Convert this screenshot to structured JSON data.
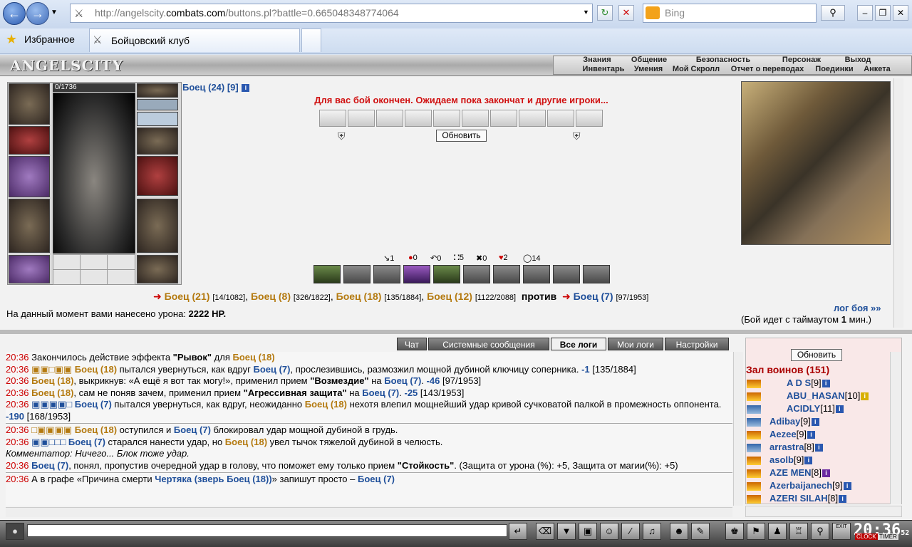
{
  "browser": {
    "url_prefix": "http://angelscity.",
    "url_domain": "combats.com",
    "url_rest": "/buttons.pl?battle=0.665048348774064",
    "search_placeholder": "Bing",
    "favorites_label": "Избранное",
    "tab_title": "Бойцовский клуб"
  },
  "game": {
    "logo": "ANGELSCITY",
    "menu_top": [
      "Знания",
      "Общение",
      "Безопасность",
      "Персонаж",
      "Выход"
    ],
    "menu_bottom": [
      "Инвентарь",
      "Умения",
      "Мой Скролл",
      "Отчет о переводах",
      "Поединки",
      "Анкета"
    ],
    "hp_label": "0/1736",
    "player_name": "Боец (24) [9]",
    "fight_message": "Для вас бой окончен. Ожидаем пока закончат и другие игроки...",
    "refresh_label": "Обновить",
    "stats": [
      "1",
      "0",
      "0",
      "5",
      "0",
      "2",
      "14"
    ],
    "team_a": [
      {
        "name": "Боец (21)",
        "hp": "[14/1082]"
      },
      {
        "name": "Боец (8)",
        "hp": "[326/1822]"
      },
      {
        "name": "Боец (18)",
        "hp": "[135/1884]"
      },
      {
        "name": "Боец (12)",
        "hp": "[1122/2088]"
      }
    ],
    "versus_label": "против",
    "team_b": [
      {
        "name": "Боец (7)",
        "hp": "[97/1953]"
      }
    ],
    "damage_prefix": "На данный момент вами нанесено урона:",
    "damage_value": "2222 HP.",
    "log_link": "лог боя »»",
    "timeout_prefix": "(Бой идет с таймаутом",
    "timeout_value": "1",
    "timeout_suffix": "мин.)"
  },
  "chat": {
    "tabs": [
      "Чат",
      "Системные сообщения",
      "Все логи",
      "Мои логи",
      "Настройки"
    ],
    "active_tab": "Все логи"
  },
  "log": [
    {
      "time": "20:36",
      "t1": "Закончилось действие эффекта ",
      "q1": "\"Рывок\"",
      "t2": " для ",
      "f1": "Боец (18)"
    },
    {
      "time": "20:36",
      "f1": "Боец (18)",
      "t1": " пытался увернуться, как вдруг ",
      "f2": "Боец (7)",
      "t2": ", прослезившись, размозжил мощной дубиной ключицу соперника. ",
      "d": "-1",
      "t3": "[135/1884]"
    },
    {
      "time": "20:36",
      "f1": "Боец (18)",
      "t1": ", выкрикнув: «А ещё я вот так могу!», применил прием ",
      "q1": "\"Возмездие\"",
      "t2": " на ",
      "f2": "Боец (7)",
      "d": "-46",
      "t3": "[97/1953]"
    },
    {
      "time": "20:36",
      "f1": "Боец (18)",
      "t1": ", сам не поняв зачем, применил прием ",
      "q1": "\"Агрессивная защита\"",
      "t2": " на ",
      "f2": "Боец (7)",
      "d": "-25",
      "t3": "[143/1953]"
    },
    {
      "time": "20:36",
      "f1": "Боец (7)",
      "t1": " пытался увернуться, как вдруг, неожиданно ",
      "f2": "Боец (18)",
      "t2": " нехотя влепил мощнейший удар кривой сучковатой палкой в промежность оппонента. ",
      "d": "-190",
      "t3": "[168/1953]"
    },
    {
      "time": "20:36",
      "f1": "Боец (18)",
      "t1": " оступился и ",
      "f2": "Боец (7)",
      "t2": " блокировал удар мощной дубиной в грудь."
    },
    {
      "time": "20:36",
      "f1": "Боец (7)",
      "t1": " старался нанести удар, но ",
      "f2": "Боец (18)",
      "t2": " увел тычок тяжелой дубиной в челюсть."
    },
    {
      "comment": "Комментатор: Ничего... Блок тоже удар."
    },
    {
      "time": "20:36",
      "f1": "Боец (7)",
      "t1": ", понял, пропустив очередной удар в голову, что поможет ему только прием ",
      "q1": "\"Стойкость\"",
      "t2": ". (Защита от урона (%): +5, Защита от магии(%): +5)"
    },
    {
      "time": "20:36",
      "t1": "А в графе «Причина смерти ",
      "q1": "Чертяка (зверь Боец (18))",
      "t2": "» запишут просто – ",
      "f2": "Боец (7)"
    }
  ],
  "room": {
    "refresh_label": "Обновить",
    "title": "Зал воинов (151)",
    "players": [
      {
        "name": "A D S",
        "level": "[9]"
      },
      {
        "name": "ABU_HASAN",
        "level": "[10]"
      },
      {
        "name": "ACIDLY",
        "level": "[11]"
      },
      {
        "name": "Adibay",
        "level": "[9]"
      },
      {
        "name": "Aezee",
        "level": "[9]"
      },
      {
        "name": "arrastra",
        "level": "[8]"
      },
      {
        "name": "asolb",
        "level": "[9]"
      },
      {
        "name": "AZE MEN",
        "level": "[8]"
      },
      {
        "name": "Azerbaijanech",
        "level": "[9]"
      },
      {
        "name": "AZERI SILAH",
        "level": "[8]"
      }
    ]
  },
  "clock": {
    "time": "20:36",
    "seconds": "52",
    "label1": "CLOCK",
    "label2": "TIMER",
    "exit": "EXIT"
  },
  "colors": {
    "accent_blue": "#1f4f9a",
    "fighter_gold": "#b47a10",
    "alert_red": "#d01010"
  }
}
